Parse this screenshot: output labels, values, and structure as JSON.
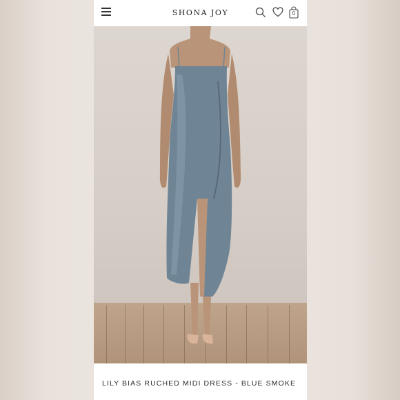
{
  "header": {
    "brand": "SHONA JOY",
    "icons": [
      "menu-icon",
      "search-icon",
      "heart-icon",
      "bag-icon"
    ],
    "bag_count": "0"
  },
  "gallery": {
    "image_alt": "Model wearing a blue smoke satin midi dress with thigh slit",
    "slide_count": 6,
    "active_slide": 1
  },
  "product": {
    "name": "LILY BIAS RUCHED MIDI DRESS - BLUE SMOKE"
  },
  "colors": {
    "dress": "#6f8595",
    "background": "#dcd4cd"
  }
}
